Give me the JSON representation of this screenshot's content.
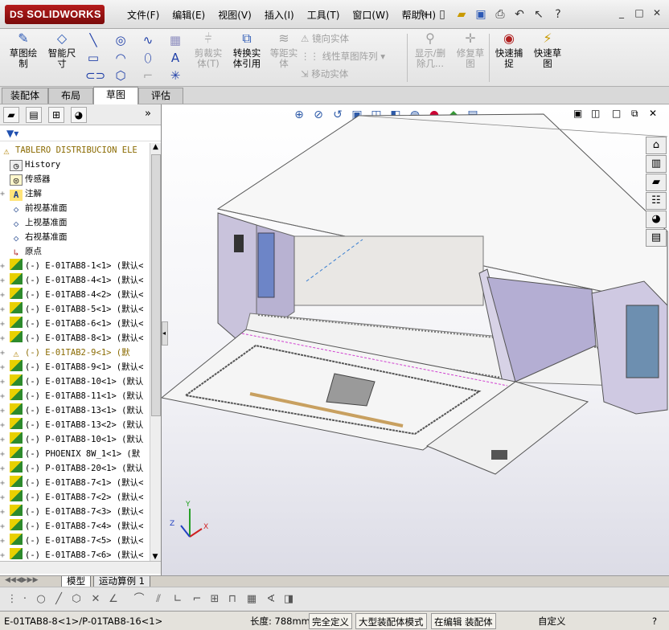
{
  "app": {
    "logo_text": "SOLIDWORKS",
    "logo_mark": "DS"
  },
  "menu": [
    "文件(F)",
    "编辑(E)",
    "视图(V)",
    "插入(I)",
    "工具(T)",
    "窗口(W)",
    "帮助(H)"
  ],
  "window_controls": [
    "_",
    "□",
    "✕"
  ],
  "command_manager": {
    "sketch": "草图绘\n制",
    "smart_dim": "智能尺\n寸",
    "trim": "剪裁实\n体(T)",
    "convert": "转换实\n体引用",
    "offset": "等距实\n体",
    "mirror": "镜向实体",
    "linear_pattern": "线性草图阵列",
    "move": "移动实体",
    "show_hide": "显示/删\n除几...",
    "repair": "修复草\n图",
    "quick_snap": "快速捕\n捉",
    "rapid_sketch": "快速草\n图"
  },
  "tabs": [
    "装配体",
    "布局",
    "草图",
    "评估"
  ],
  "active_tab": "草图",
  "tree": {
    "root": "TABLERO DISTRIBUCION ELE",
    "items": [
      {
        "label": "History",
        "icon": "history-icon",
        "pm": ""
      },
      {
        "label": "传感器",
        "icon": "sensor-icon",
        "pm": ""
      },
      {
        "label": "注解",
        "icon": "annotation-icon",
        "pm": "+"
      },
      {
        "label": "前视基准面",
        "icon": "plane-icon",
        "pm": ""
      },
      {
        "label": "上视基准面",
        "icon": "plane-icon",
        "pm": ""
      },
      {
        "label": "右视基准面",
        "icon": "plane-icon",
        "pm": ""
      },
      {
        "label": "原点",
        "icon": "origin-icon",
        "pm": ""
      },
      {
        "label": "(-) E-01TAB8-1<1> (默认<",
        "icon": "part-icon",
        "pm": "+"
      },
      {
        "label": "(-) E-01TAB8-4<1> (默认<",
        "icon": "part-icon",
        "pm": "+"
      },
      {
        "label": "(-) E-01TAB8-4<2> (默认<",
        "icon": "part-icon",
        "pm": "+"
      },
      {
        "label": "(-) E-01TAB8-5<1> (默认<",
        "icon": "part-icon",
        "pm": "+"
      },
      {
        "label": "(-) E-01TAB8-6<1> (默认<",
        "icon": "part-icon",
        "pm": "+"
      },
      {
        "label": "(-) E-01TAB8-8<1> (默认<",
        "icon": "part-icon",
        "pm": "+"
      },
      {
        "label": "(-) E-01TAB2-9<1> (默",
        "icon": "warning-icon",
        "pm": "+",
        "warn": true
      },
      {
        "label": "(-) E-01TAB8-9<1> (默认<",
        "icon": "part-icon",
        "pm": "+"
      },
      {
        "label": "(-) E-01TAB8-10<1> (默认",
        "icon": "part-icon",
        "pm": "+"
      },
      {
        "label": "(-) E-01TAB8-11<1> (默认",
        "icon": "part-icon",
        "pm": "+"
      },
      {
        "label": "(-) E-01TAB8-13<1> (默认",
        "icon": "part-icon",
        "pm": "+"
      },
      {
        "label": "(-) E-01TAB8-13<2> (默认",
        "icon": "part-icon",
        "pm": "+"
      },
      {
        "label": "(-) P-01TAB8-10<1> (默认",
        "icon": "part-icon",
        "pm": "+"
      },
      {
        "label": "(-) PHOENIX 8W_1<1> (默",
        "icon": "part-icon",
        "pm": "+"
      },
      {
        "label": "(-) P-01TAB8-20<1> (默认",
        "icon": "part-icon",
        "pm": "+"
      },
      {
        "label": "(-) E-01TAB8-7<1> (默认<",
        "icon": "part-icon",
        "pm": "+"
      },
      {
        "label": "(-) E-01TAB8-7<2> (默认<",
        "icon": "part-icon",
        "pm": "+"
      },
      {
        "label": "(-) E-01TAB8-7<3> (默认<",
        "icon": "part-icon",
        "pm": "+"
      },
      {
        "label": "(-) E-01TAB8-7<4> (默认<",
        "icon": "part-icon",
        "pm": "+"
      },
      {
        "label": "(-) E-01TAB8-7<5> (默认<",
        "icon": "part-icon",
        "pm": "+"
      },
      {
        "label": "(-) E-01TAB8-7<6> (默认<",
        "icon": "part-icon",
        "pm": "+"
      }
    ]
  },
  "bottom_tabs": [
    "模型",
    "运动算例 1"
  ],
  "triad": {
    "x": "X",
    "y": "Y",
    "z": "Z"
  },
  "status": {
    "selection": "E-01TAB8-8<1>/P-01TAB8-16<1>",
    "length": "长度: 788mm",
    "defined": "完全定义",
    "mode": "大型装配体模式",
    "editing": "在编辑 装配体",
    "custom": "自定义"
  }
}
